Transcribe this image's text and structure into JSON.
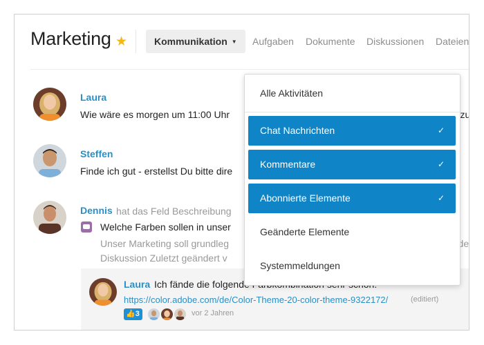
{
  "header": {
    "title": "Marketing",
    "tabs": [
      {
        "label": "Kommunikation",
        "active": true
      },
      {
        "label": "Aufgaben"
      },
      {
        "label": "Dokumente"
      },
      {
        "label": "Diskussionen"
      },
      {
        "label": "Dateien"
      }
    ]
  },
  "messages": [
    {
      "author": "Laura",
      "text": "Wie wäre es morgen um 11:00 Uhr",
      "text_tail": "en zu"
    },
    {
      "author": "Steffen",
      "text": "Finde ich gut - erstellst Du bitte dire"
    },
    {
      "author": "Dennis",
      "action": "hat das Feld Beschreibung",
      "text": "Welche Farben sollen in unser",
      "subtext": "Unser Marketing soll grundleg",
      "subtext_tail": "würde",
      "meta": "Diskussion  Zuletzt geändert v"
    }
  ],
  "reply": {
    "author": "Laura",
    "text": "Ich fände die folgende Farbkombination sehr schön:",
    "link": "https://color.adobe.com/de/Color-Theme-20-color-theme-9322172/",
    "edited": "(editiert)",
    "likes": "3",
    "ago": "vor 2 Jahren"
  },
  "dropdown": {
    "items": [
      {
        "label": "Alle Aktivitäten",
        "selected": false
      },
      {
        "label": "Chat Nachrichten",
        "selected": true
      },
      {
        "label": "Kommentare",
        "selected": true
      },
      {
        "label": "Abonnierte Elemente",
        "selected": true
      },
      {
        "label": "Geänderte Elemente",
        "selected": false
      },
      {
        "label": "Systemmeldungen",
        "selected": false
      }
    ],
    "check": "✓"
  },
  "icons": {
    "star": "★",
    "caret": "▼",
    "thumbs_up": "👍"
  },
  "colors": {
    "accent": "#0f84c6",
    "link": "#2a8fc6",
    "star": "#f3b71b"
  }
}
